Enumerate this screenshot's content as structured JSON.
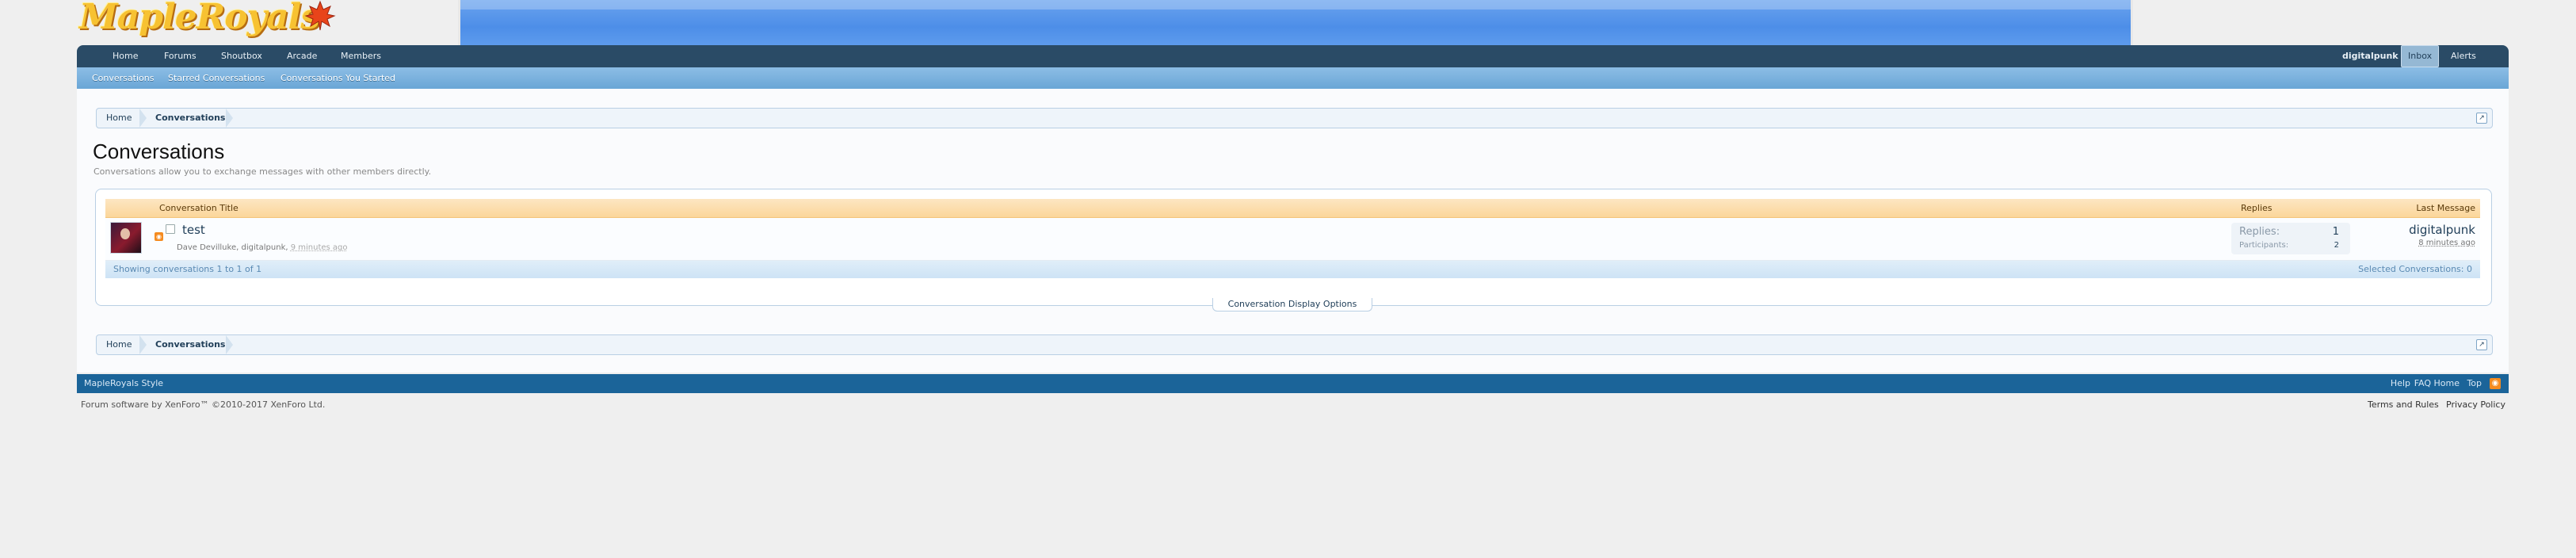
{
  "header": {
    "logo_text": "MapleRoyals"
  },
  "nav": {
    "tabs": [
      {
        "label": "Home"
      },
      {
        "label": "Forums"
      },
      {
        "label": "Shoutbox"
      },
      {
        "label": "Arcade"
      },
      {
        "label": "Members"
      }
    ],
    "user": "digitalpunk",
    "inbox": "Inbox",
    "alerts": "Alerts"
  },
  "subnav": {
    "items": [
      {
        "label": "Conversations"
      },
      {
        "label": "Starred Conversations"
      },
      {
        "label": "Conversations You Started"
      }
    ]
  },
  "breadcrumb": {
    "home": "Home",
    "current": "Conversations",
    "jump_icon": "↗"
  },
  "page": {
    "title": "Conversations",
    "description": "Conversations allow you to exchange messages with other members directly."
  },
  "list": {
    "columns": {
      "title": "Conversation Title",
      "replies": "Replies",
      "last_message": "Last Message"
    },
    "rows": [
      {
        "title": "test",
        "participants_text": "Dave Devilluke, digitalpunk,",
        "time": "9 minutes ago",
        "replies_label": "Replies:",
        "replies": "1",
        "participants_label": "Participants:",
        "participants": "2",
        "last_user": "digitalpunk",
        "last_time": "8 minutes ago"
      }
    ],
    "footer": {
      "showing": "Showing conversations 1 to 1 of 1",
      "selected": "Selected Conversations: 0"
    },
    "display_options": "Conversation Display Options"
  },
  "footer": {
    "style": "MapleRoyals Style",
    "links": [
      {
        "label": "Help"
      },
      {
        "label": "FAQ"
      },
      {
        "label": "Home"
      },
      {
        "label": "Top"
      }
    ],
    "copyright": "Forum software by XenForo™ ©2010-2017 XenForo Ltd.",
    "terms": "Terms and Rules",
    "privacy": "Privacy Policy"
  },
  "icons": {
    "rss": "rss-icon",
    "jump": "external-link-icon",
    "leaf": "maple-leaf-icon"
  },
  "colors": {
    "nav_dark": "#2a4b66",
    "subnav": "#6aa6d6",
    "footer": "#1b6499",
    "header_orange": "#fbd69a",
    "banner": "#4d8ee8"
  }
}
